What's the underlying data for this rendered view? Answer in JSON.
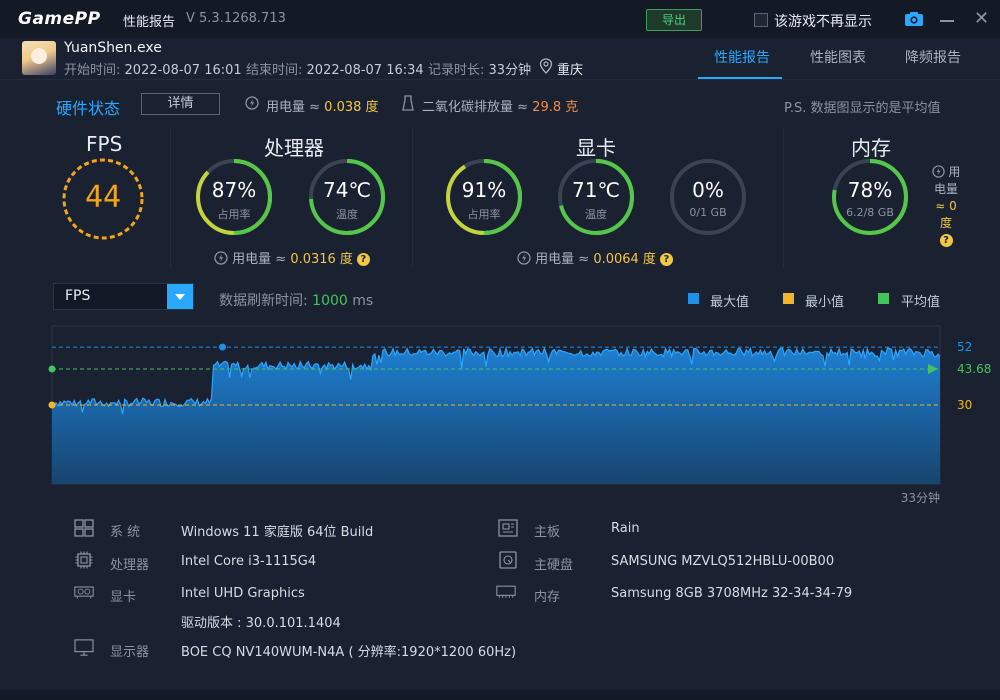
{
  "app": {
    "logo": "GamePP",
    "title": "性能报告",
    "version": "V 5.3.1268.713",
    "export_label": "导出",
    "hide_label": "该游戏不再显示"
  },
  "session": {
    "exe": "YuanShen.exe",
    "start_label": "开始时间:",
    "start_value": "2022-08-07 16:01",
    "end_label": "结束时间:",
    "end_value": "2022-08-07 16:34",
    "duration_label": "记录时长:",
    "duration_value": "33分钟",
    "city": "重庆"
  },
  "tabs": [
    {
      "label": "性能报告",
      "active": true
    },
    {
      "label": "性能图表",
      "active": false
    },
    {
      "label": "降频报告",
      "active": false
    }
  ],
  "hardware": {
    "title": "硬件状态",
    "detail_label": "详情",
    "power_label": "用电量 ≈",
    "power_value": "0.038 度",
    "co2_label": "二氧化碳排放量 ≈",
    "co2_value": "29.8 克",
    "note": "P.S. 数据图显示的是平均值"
  },
  "fps": {
    "title": "FPS",
    "value": "44"
  },
  "cpu": {
    "title": "处理器",
    "usage": {
      "value": "87%",
      "label": "占用率",
      "percent": 87
    },
    "temp": {
      "value": "74℃",
      "label": "温度",
      "percent": 74
    },
    "power_label": "用电量 ≈",
    "power_value": "0.0316 度"
  },
  "gpu": {
    "title": "显卡",
    "usage": {
      "value": "91%",
      "label": "占用率",
      "percent": 91
    },
    "temp": {
      "value": "71℃",
      "label": "温度",
      "percent": 71
    },
    "vram": {
      "value": "0%",
      "label": "0/1 GB",
      "percent": 0
    },
    "power_label": "用电量 ≈",
    "power_value": "0.0064 度"
  },
  "memory": {
    "title": "内存",
    "usage": {
      "value": "78%",
      "label": "6.2/8 GB",
      "percent": 78
    },
    "power_line1": "用",
    "power_line2": "电量",
    "power_value": "≈ 0 度"
  },
  "chart_controls": {
    "select_label": "FPS",
    "refresh_label": "数据刷新时间:",
    "refresh_value": "1000",
    "refresh_unit": "ms"
  },
  "legend": [
    {
      "label": "最大值",
      "color": "#1e90e8"
    },
    {
      "label": "最小值",
      "color": "#f2b52a"
    },
    {
      "label": "平均值",
      "color": "#44c45a"
    }
  ],
  "chart_data": {
    "type": "area",
    "title": "",
    "xlabel": "",
    "ylabel": "",
    "x_end_label": "33分钟",
    "ylim": [
      0,
      60
    ],
    "max_value": 52,
    "min_value": 30,
    "avg_value": 43.68,
    "max_label": "52",
    "min_label": "30",
    "avg_label": "43.68",
    "series": [
      {
        "segments": [
          {
            "from": 0,
            "to": 0.18,
            "level": 31
          },
          {
            "from": 0.18,
            "to": 0.36,
            "level": 45
          },
          {
            "from": 0.36,
            "to": 1.0,
            "level": 50
          }
        ]
      }
    ]
  },
  "system": {
    "os_label": "系  统",
    "os_value": "Windows 11 家庭版 64位   Build",
    "cpu_label": "处理器",
    "cpu_value": "Intel Core i3-1115G4",
    "gpu_label": "显卡",
    "gpu_value": "Intel UHD Graphics",
    "driver_value": "驱动版本 : 30.0.101.1404",
    "display_label": "显示器",
    "display_value": "BOE CQ NV140WUM-N4A ( 分辨率:1920*1200 60Hz)",
    "board_label": "主板",
    "board_value": "Rain",
    "disk_label": "主硬盘",
    "disk_value": "SAMSUNG MZVLQ512HBLU-00B00",
    "ram_label": "内存",
    "ram_value": "Samsung 8GB 3708MHz 32-34-34-79"
  }
}
